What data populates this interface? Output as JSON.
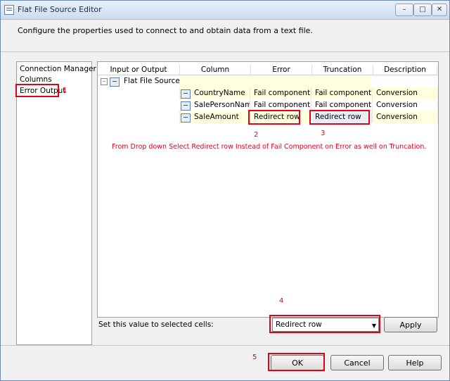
{
  "window": {
    "title": "Flat File Source Editor",
    "buttons": {
      "minimize": "–",
      "maximize": "□",
      "close": "✕"
    }
  },
  "header": {
    "description": "Configure the properties used to connect to and obtain data from a text file."
  },
  "nav": {
    "items": [
      {
        "label": "Connection Manager"
      },
      {
        "label": "Columns"
      },
      {
        "label": "Error Output"
      }
    ]
  },
  "grid": {
    "headers": [
      "Input or Output",
      "Column",
      "Error",
      "Truncation",
      "Description"
    ],
    "group": {
      "expand_symbol": "–",
      "label": "Flat File Source ..."
    },
    "rows": [
      {
        "column": "CountryName",
        "error": "Fail component",
        "truncation": "Fail component",
        "description": "Conversion"
      },
      {
        "column": "SalePersonName",
        "error": "Fail component",
        "truncation": "Fail component",
        "description": "Conversion"
      },
      {
        "column": "SaleAmount",
        "error": "Redirect row",
        "truncation": "Redirect row",
        "description": "Conversion"
      }
    ]
  },
  "annotations": {
    "step1": "1",
    "step2": "2",
    "step3": "3",
    "step4": "4",
    "step5": "5",
    "note": "From Drop down Select Redirect row Instead of Fail Component on Error as well on Truncation."
  },
  "bottom": {
    "set_label": "Set this value to selected cells:",
    "select_value": "Redirect row",
    "apply": "Apply",
    "ok": "OK",
    "cancel": "Cancel",
    "help": "Help"
  },
  "colors": {
    "annotation_red": "#e3001b",
    "highlight_row": "#ffffe0"
  }
}
